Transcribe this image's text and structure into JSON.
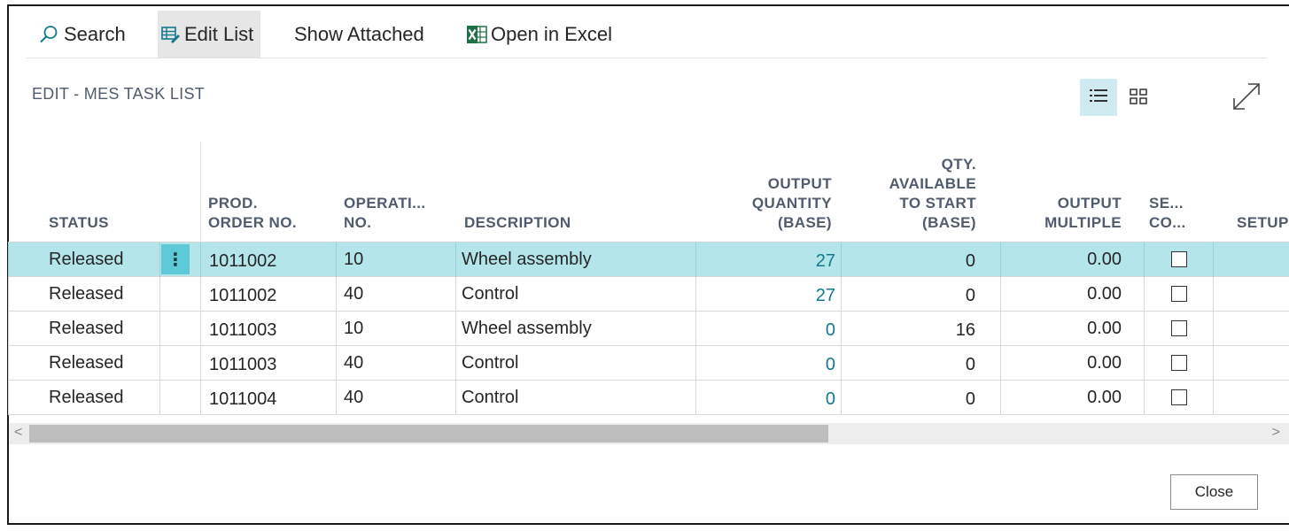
{
  "toolbar": {
    "search_label": "Search",
    "edit_list_label": "Edit List",
    "show_attached_label": "Show Attached",
    "open_excel_label": "Open in Excel"
  },
  "page_title": "EDIT - MES TASK LIST",
  "columns": {
    "status": "STATUS",
    "prod_order_no_1": "PROD.",
    "prod_order_no_2": "ORDER NO.",
    "operation_no_1": "OPERATI...",
    "operation_no_2": "NO.",
    "description": "DESCRIPTION",
    "output_qty_1": "OUTPUT",
    "output_qty_2": "QUANTITY",
    "output_qty_3": "(BASE)",
    "qty_avail_1": "QTY.",
    "qty_avail_2": "AVAILABLE",
    "qty_avail_3": "TO START",
    "qty_avail_4": "(BASE)",
    "output_multiple_1": "OUTPUT",
    "output_multiple_2": "MULTIPLE",
    "se_co_1": "SE...",
    "se_co_2": "CO...",
    "setup": "SETUP"
  },
  "rows": [
    {
      "status": "Released",
      "prod_order_no": "1011002",
      "operation_no": "10",
      "description": "Wheel assembly",
      "output_qty": "27",
      "qty_avail": "0",
      "output_multiple": "0.00",
      "checked": false
    },
    {
      "status": "Released",
      "prod_order_no": "1011002",
      "operation_no": "40",
      "description": "Control",
      "output_qty": "27",
      "qty_avail": "0",
      "output_multiple": "0.00",
      "checked": false
    },
    {
      "status": "Released",
      "prod_order_no": "1011003",
      "operation_no": "10",
      "description": "Wheel assembly",
      "output_qty": "0",
      "qty_avail": "16",
      "output_multiple": "0.00",
      "checked": false
    },
    {
      "status": "Released",
      "prod_order_no": "1011003",
      "operation_no": "40",
      "description": "Control",
      "output_qty": "0",
      "qty_avail": "0",
      "output_multiple": "0.00",
      "checked": false
    },
    {
      "status": "Released",
      "prod_order_no": "1011004",
      "operation_no": "40",
      "description": "Control",
      "output_qty": "0",
      "qty_avail": "0",
      "output_multiple": "0.00",
      "checked": false
    }
  ],
  "row_actions_glyph": "⋮",
  "close_label": "Close",
  "icons": {
    "search": "search-icon",
    "edit_list": "edit-list-icon",
    "excel": "excel-icon",
    "list_view": "list-view-icon",
    "tile_view": "tile-view-icon",
    "expand": "expand-icon"
  },
  "colors": {
    "selected_row": "#b3e5ea",
    "link_value": "#117b8c",
    "accent": "#5ec9d6"
  }
}
